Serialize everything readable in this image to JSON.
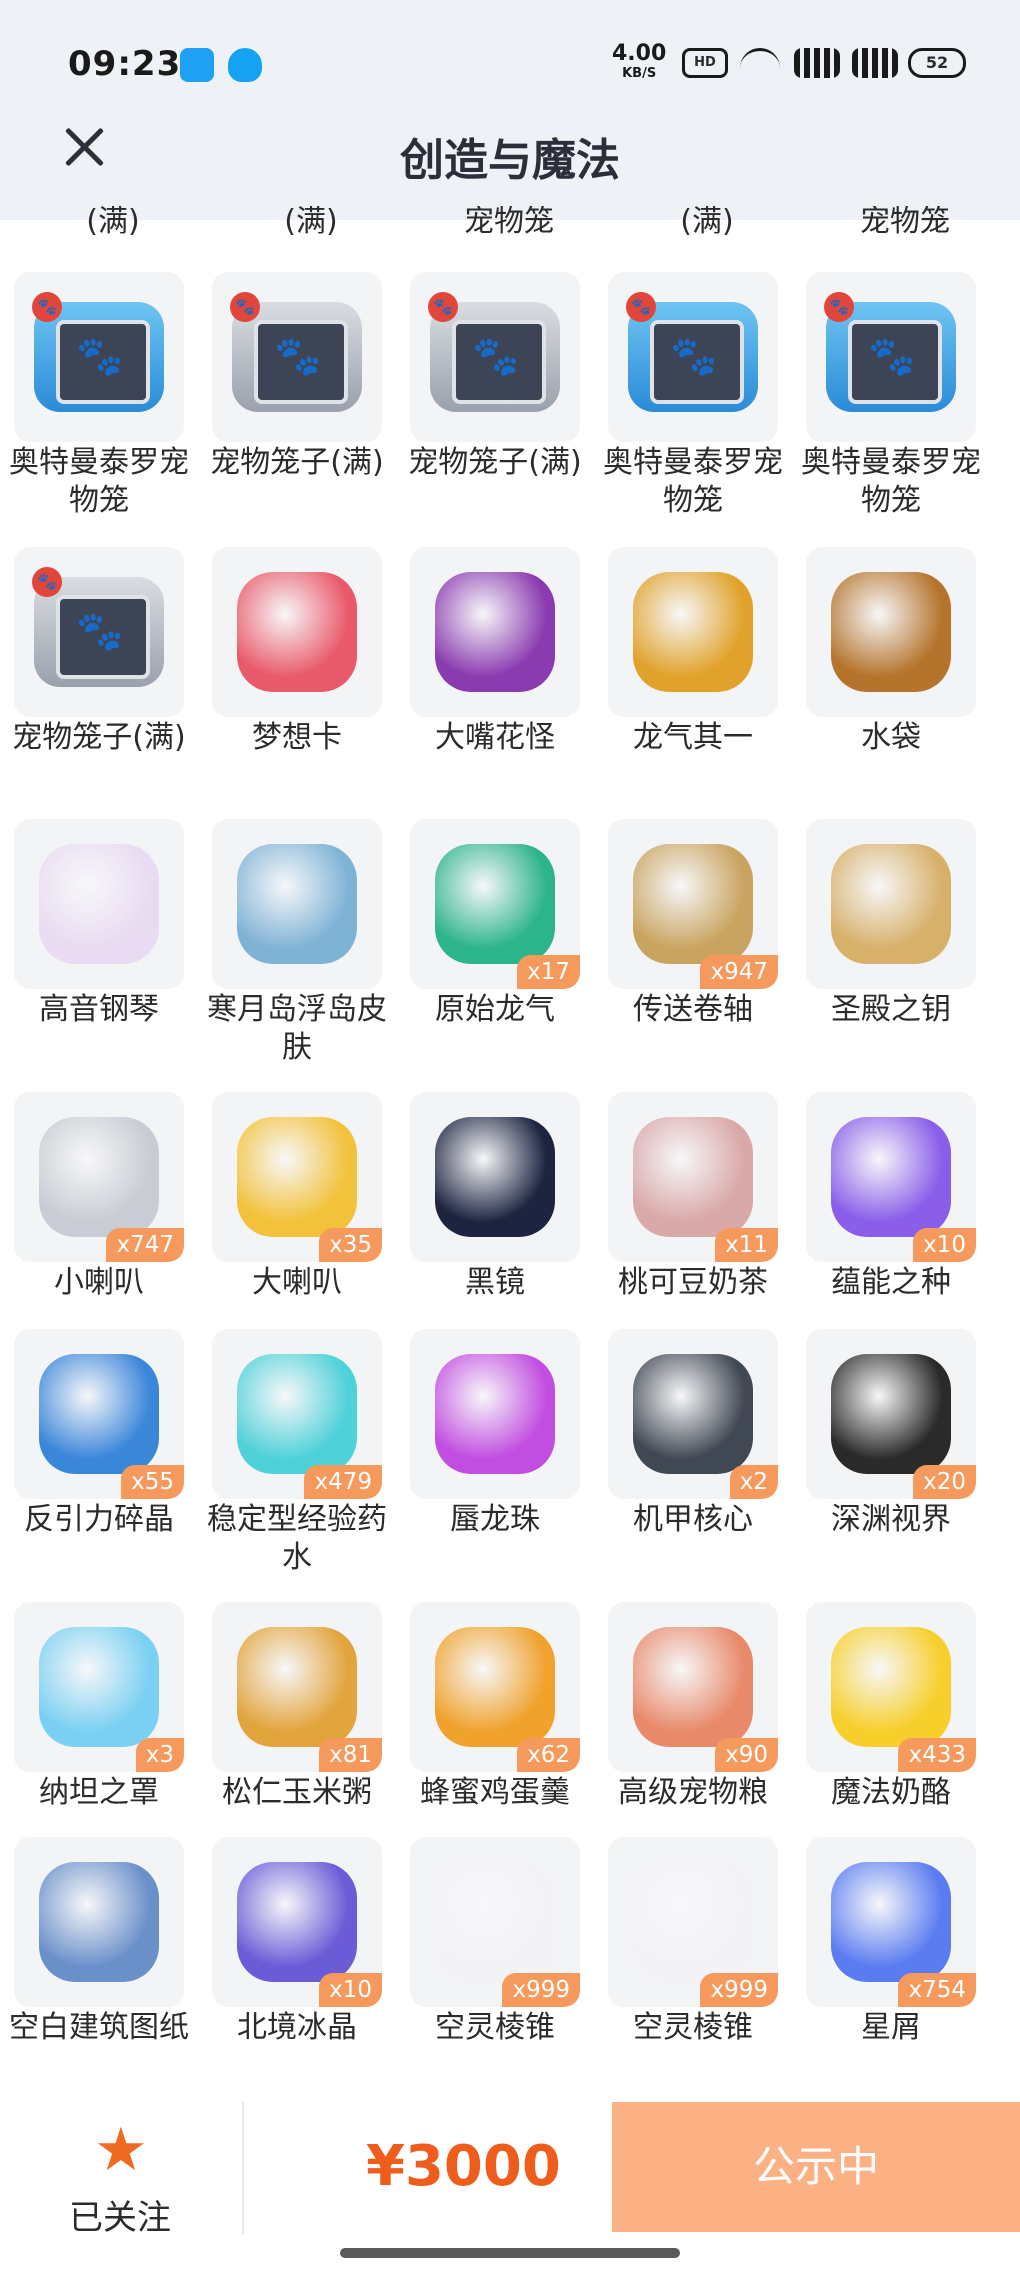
{
  "status_bar": {
    "time": "09:23",
    "net_speed": "4.00",
    "net_unit": "KB/S",
    "hd_label": "HD",
    "battery": "52"
  },
  "header": {
    "title": "创造与魔法",
    "close_icon": "close-icon"
  },
  "partial_row": [
    "(满)",
    "(满)",
    "宠物笼",
    "(满)",
    "宠物笼"
  ],
  "items": [
    {
      "name": "奥特曼泰罗宠物笼",
      "count": "",
      "icon": "pet-cage-blue-icon"
    },
    {
      "name": "宠物笼子(满)",
      "count": "",
      "icon": "pet-cage-grey-icon"
    },
    {
      "name": "宠物笼子(满)",
      "count": "",
      "icon": "pet-cage-grey-icon"
    },
    {
      "name": "奥特曼泰罗宠物笼",
      "count": "",
      "icon": "pet-cage-blue-icon"
    },
    {
      "name": "奥特曼泰罗宠物笼",
      "count": "",
      "icon": "pet-cage-blue-icon"
    },
    {
      "name": "宠物笼子(满)",
      "count": "",
      "icon": "pet-cage-grey-icon"
    },
    {
      "name": "梦想卡",
      "count": "",
      "icon": "dream-card-icon"
    },
    {
      "name": "大嘴花怪",
      "count": "",
      "icon": "big-mouth-flower-icon"
    },
    {
      "name": "龙气其一",
      "count": "",
      "icon": "dragon-qi-icon"
    },
    {
      "name": "水袋",
      "count": "",
      "icon": "water-bag-icon"
    },
    {
      "name": "高音钢琴",
      "count": "",
      "icon": "piano-icon"
    },
    {
      "name": "寒月岛浮岛皮肤",
      "count": "",
      "icon": "floating-island-icon"
    },
    {
      "name": "原始龙气",
      "count": "x17",
      "icon": "green-crystal-icon"
    },
    {
      "name": "传送卷轴",
      "count": "x947",
      "icon": "teleport-scroll-icon"
    },
    {
      "name": "圣殿之钥",
      "count": "",
      "icon": "temple-key-icon"
    },
    {
      "name": "小喇叭",
      "count": "x747",
      "icon": "small-megaphone-icon"
    },
    {
      "name": "大喇叭",
      "count": "x35",
      "icon": "big-megaphone-icon"
    },
    {
      "name": "黑镜",
      "count": "",
      "icon": "black-mirror-icon"
    },
    {
      "name": "桃可豆奶茶",
      "count": "x11",
      "icon": "milk-tea-icon"
    },
    {
      "name": "蕴能之种",
      "count": "x10",
      "icon": "purple-crystal-icon"
    },
    {
      "name": "反引力碎晶",
      "count": "x55",
      "icon": "anti-gravity-crystal-icon"
    },
    {
      "name": "稳定型经验药水",
      "count": "x479",
      "icon": "exp-potion-icon"
    },
    {
      "name": "蜃龙珠",
      "count": "",
      "icon": "purple-orb-icon"
    },
    {
      "name": "机甲核心",
      "count": "x2",
      "icon": "mech-core-icon"
    },
    {
      "name": "深渊视界",
      "count": "x20",
      "icon": "abyss-vision-icon"
    },
    {
      "name": "纳坦之罩",
      "count": "x3",
      "icon": "hex-shield-icon"
    },
    {
      "name": "松仁玉米粥",
      "count": "x81",
      "icon": "corn-porridge-icon"
    },
    {
      "name": "蜂蜜鸡蛋羹",
      "count": "x62",
      "icon": "egg-custard-icon"
    },
    {
      "name": "高级宠物粮",
      "count": "x90",
      "icon": "pet-food-bag-icon"
    },
    {
      "name": "魔法奶酪",
      "count": "x433",
      "icon": "cheese-icon"
    },
    {
      "name": "空白建筑图纸",
      "count": "",
      "icon": "blueprint-icon"
    },
    {
      "name": "北境冰晶",
      "count": "x10",
      "icon": "ice-crystal-icon"
    },
    {
      "name": "空灵棱锥",
      "count": "x999",
      "icon": "pyramid-icon"
    },
    {
      "name": "空灵棱锥",
      "count": "x999",
      "icon": "pyramid-icon"
    },
    {
      "name": "星屑",
      "count": "x754",
      "icon": "star-dust-icon"
    }
  ],
  "art_colors": {
    "dream-card-icon": "#e85a6a",
    "big-mouth-flower-icon": "#8a3bb0",
    "dragon-qi-icon": "#e0a22a",
    "water-bag-icon": "#b5742c",
    "piano-icon": "#e9dbf2",
    "floating-island-icon": "#7fb3d6",
    "green-crystal-icon": "#2cb48a",
    "teleport-scroll-icon": "#c9a460",
    "temple-key-icon": "#d7b06a",
    "small-megaphone-icon": "#c9ccd4",
    "big-megaphone-icon": "#f2c23a",
    "black-mirror-icon": "#1c2440",
    "milk-tea-icon": "#d9a8a8",
    "purple-crystal-icon": "#8a5ee8",
    "anti-gravity-crystal-icon": "#3a86d9",
    "exp-potion-icon": "#4fd1d9",
    "purple-orb-icon": "#c14ee0",
    "mech-core-icon": "#404854",
    "abyss-vision-icon": "#2a2a2a",
    "hex-shield-icon": "#7ad0f2",
    "corn-porridge-icon": "#e2a43c",
    "egg-custard-icon": "#f0a22c",
    "pet-food-bag-icon": "#e88a6a",
    "cheese-icon": "#f7cf2a",
    "blueprint-icon": "#6a90c9",
    "ice-crystal-icon": "#6a5bd6",
    "pyramid-icon": "#f3f3f5",
    "star-dust-icon": "#5a7cf0"
  },
  "bottom_bar": {
    "follow_label": "已关注",
    "price": "¥3000",
    "status_button": "公示中",
    "accent": "#ee5d1c",
    "button_color": "#fbb183"
  }
}
